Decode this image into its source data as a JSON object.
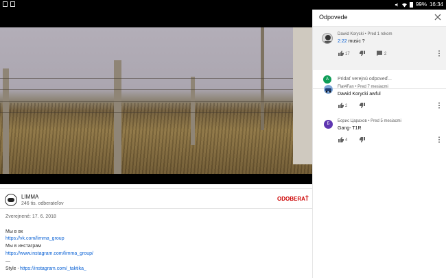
{
  "status_bar": {
    "battery": "99%",
    "time": "16:34"
  },
  "video": {
    "channel_watermark": "LIMMA"
  },
  "channel": {
    "name": "LIMMA",
    "subscribers": "246 tis. odberateľov",
    "subscribe_label": "ODOBERAŤ"
  },
  "description": {
    "published": "Zverejnené: 17. 6. 2018",
    "lines": [
      "Мы в вк",
      "https://vk.com/limma_group",
      "Мы в инстаграм",
      "https://www.instagram.com/limma_group/",
      "—",
      "Style - ",
      "https://instagram.com/_taktika_"
    ]
  },
  "replies_panel": {
    "title": "Odpovede",
    "original_comment": {
      "author": "Dawid Korycki",
      "time": "Pred 1 rokom",
      "timestamp_link": "2:22",
      "text": " music ?",
      "likes": "17",
      "replies": "2"
    },
    "reply_placeholder": "Pridať verejnú odpoveď...",
    "reply_avatar_letter": "A",
    "replies": [
      {
        "author": "Flat4Fan",
        "time": "Pred 7 mesiacmi",
        "text": "Dawid Korycki awful",
        "likes": "2",
        "avatar_letter": ""
      },
      {
        "author": "Борис Царахов",
        "time": "Pred 5 mesiacmi",
        "text": "Gang- T1R",
        "likes": "4",
        "avatar_letter": "Б"
      }
    ]
  },
  "colors": {
    "subscribe_red": "#cc0000",
    "link_blue": "#065fd4",
    "reply_avatar": "#0f9d58",
    "boris_avatar": "#5e35b1"
  }
}
